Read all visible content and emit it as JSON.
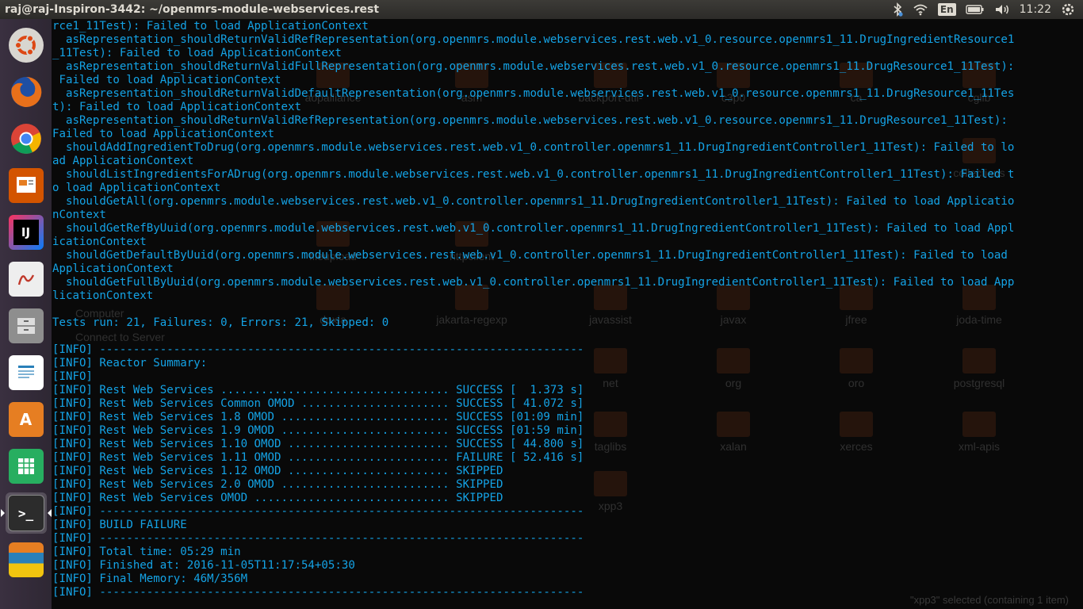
{
  "window": {
    "title": "raj@raj-Inspiron-3442: ~/openmrs-module-webservices.rest"
  },
  "tray": {
    "bluetooth_icon": "bluetooth-icon",
    "wifi_icon": "wifi-icon",
    "keyboard_layout": "En",
    "battery_icon": "battery-icon",
    "volume_icon": "volume-icon",
    "clock": "11:22",
    "session_icon": "gear-icon"
  },
  "launcher": {
    "items": [
      {
        "name": "ubuntu-dash",
        "icon": "ubuntu-logo-icon",
        "color": "#e05a2b"
      },
      {
        "name": "firefox",
        "icon": "firefox-icon",
        "color": "#e8701a"
      },
      {
        "name": "chrome",
        "icon": "chrome-icon",
        "color": "#4285f4"
      },
      {
        "name": "impress",
        "icon": "presentation-icon",
        "color": "#d35400"
      },
      {
        "name": "intellij",
        "icon": "intellij-icon",
        "color": "#1a1a1a",
        "label": "IJ"
      },
      {
        "name": "document-viewer",
        "icon": "pdf-icon",
        "color": "#c0392b"
      },
      {
        "name": "files",
        "icon": "file-cabinet-icon",
        "color": "#7f8c8d"
      },
      {
        "name": "writer",
        "icon": "document-icon",
        "color": "#2980b9"
      },
      {
        "name": "software-center",
        "icon": "shopping-bag-icon",
        "color": "#e67e22",
        "label": "A"
      },
      {
        "name": "calc",
        "icon": "spreadsheet-icon",
        "color": "#27ae60"
      },
      {
        "name": "terminal",
        "icon": "terminal-icon",
        "color": "#2c2c2c",
        "label": ">_"
      },
      {
        "name": "misc-stack",
        "icon": "stacked-apps-icon",
        "color": "#95a5a6"
      }
    ]
  },
  "terminal": {
    "lines": [
      "rce1_11Test): Failed to load ApplicationContext",
      "  asRepresentation_shouldReturnValidRefRepresentation(org.openmrs.module.webservices.rest.web.v1_0.resource.openmrs1_11.DrugIngredientResource1",
      "_11Test): Failed to load ApplicationContext",
      "  asRepresentation_shouldReturnValidFullRepresentation(org.openmrs.module.webservices.rest.web.v1_0.resource.openmrs1_11.DrugResource1_11Test):",
      " Failed to load ApplicationContext",
      "  asRepresentation_shouldReturnValidDefaultRepresentation(org.openmrs.module.webservices.rest.web.v1_0.resource.openmrs1_11.DrugResource1_11Tes",
      "t): Failed to load ApplicationContext",
      "  asRepresentation_shouldReturnValidRefRepresentation(org.openmrs.module.webservices.rest.web.v1_0.resource.openmrs1_11.DrugResource1_11Test):",
      "Failed to load ApplicationContext",
      "  shouldAddIngredientToDrug(org.openmrs.module.webservices.rest.web.v1_0.controller.openmrs1_11.DrugIngredientController1_11Test): Failed to lo",
      "ad ApplicationContext",
      "  shouldListIngredientsForADrug(org.openmrs.module.webservices.rest.web.v1_0.controller.openmrs1_11.DrugIngredientController1_11Test): Failed t",
      "o load ApplicationContext",
      "  shouldGetAll(org.openmrs.module.webservices.rest.web.v1_0.controller.openmrs1_11.DrugIngredientController1_11Test): Failed to load Applicatio",
      "nContext",
      "  shouldGetRefByUuid(org.openmrs.module.webservices.rest.web.v1_0.controller.openmrs1_11.DrugIngredientController1_11Test): Failed to load Appl",
      "icationContext",
      "  shouldGetDefaultByUuid(org.openmrs.module.webservices.rest.web.v1_0.controller.openmrs1_11.DrugIngredientController1_11Test): Failed to load",
      "ApplicationContext",
      "  shouldGetFullByUuid(org.openmrs.module.webservices.rest.web.v1_0.controller.openmrs1_11.DrugIngredientController1_11Test): Failed to load App",
      "licationContext",
      "",
      "Tests run: 21, Failures: 0, Errors: 21, Skipped: 0",
      "",
      "[INFO] ------------------------------------------------------------------------",
      "[INFO] Reactor Summary:",
      "[INFO]",
      "[INFO] Rest Web Services .................................. SUCCESS [  1.373 s]",
      "[INFO] Rest Web Services Common OMOD ...................... SUCCESS [ 41.072 s]",
      "[INFO] Rest Web Services 1.8 OMOD ......................... SUCCESS [01:09 min]",
      "[INFO] Rest Web Services 1.9 OMOD ......................... SUCCESS [01:59 min]",
      "[INFO] Rest Web Services 1.10 OMOD ........................ SUCCESS [ 44.800 s]",
      "[INFO] Rest Web Services 1.11 OMOD ........................ FAILURE [ 52.416 s]",
      "[INFO] Rest Web Services 1.12 OMOD ........................ SKIPPED",
      "[INFO] Rest Web Services 2.0 OMOD ......................... SKIPPED",
      "[INFO] Rest Web Services OMOD ............................. SKIPPED",
      "[INFO] ------------------------------------------------------------------------",
      "[INFO] BUILD FAILURE",
      "[INFO] ------------------------------------------------------------------------",
      "[INFO] Total time: 05:29 min",
      "[INFO] Finished at: 2016-11-05T11:17:54+05:30",
      "[INFO] Final Memory: 46M/356M",
      "[INFO] ------------------------------------------------------------------------"
    ]
  },
  "background_window": {
    "files": [
      {
        "label": "aopalliance",
        "row": 0,
        "col": 1
      },
      {
        "label": "asm",
        "row": 0,
        "col": 2
      },
      {
        "label": "backport-util-",
        "row": 0,
        "col": 3
      },
      {
        "label": "c3p0",
        "row": 0,
        "col": 4
      },
      {
        "label": "ca",
        "row": 0,
        "col": 5
      },
      {
        "label": "cglib",
        "row": 0,
        "col": 6
      },
      {
        "label": "collections",
        "row": 1,
        "col": 6
      },
      {
        "label": "fileupload",
        "row": 2,
        "col": 1
      },
      {
        "label": "httpclient",
        "row": 2,
        "col": 2
      },
      {
        "label": "doxia",
        "row": 3,
        "col": 1
      },
      {
        "label": "jakarta-regexp",
        "row": 3,
        "col": 2
      },
      {
        "label": "javassist",
        "row": 3,
        "col": 3
      },
      {
        "label": "javax",
        "row": 3,
        "col": 4
      },
      {
        "label": "jfree",
        "row": 3,
        "col": 5
      },
      {
        "label": "joda-time",
        "row": 3,
        "col": 6
      },
      {
        "label": "net",
        "row": 4,
        "col": 3
      },
      {
        "label": "org",
        "row": 4,
        "col": 4
      },
      {
        "label": "oro",
        "row": 4,
        "col": 5
      },
      {
        "label": "postgresql",
        "row": 4,
        "col": 6
      },
      {
        "label": "taglibs",
        "row": 5,
        "col": 3
      },
      {
        "label": "xalan",
        "row": 5,
        "col": 4
      },
      {
        "label": "xerces",
        "row": 5,
        "col": 5
      },
      {
        "label": "xml-apis",
        "row": 5,
        "col": 6
      },
      {
        "label": "xpp3",
        "row": 6,
        "col": 3
      }
    ],
    "sidebar_labels": [
      "Computer",
      "Connect to Server"
    ],
    "status": "\"xpp3\" selected  (containing 1 item)"
  }
}
